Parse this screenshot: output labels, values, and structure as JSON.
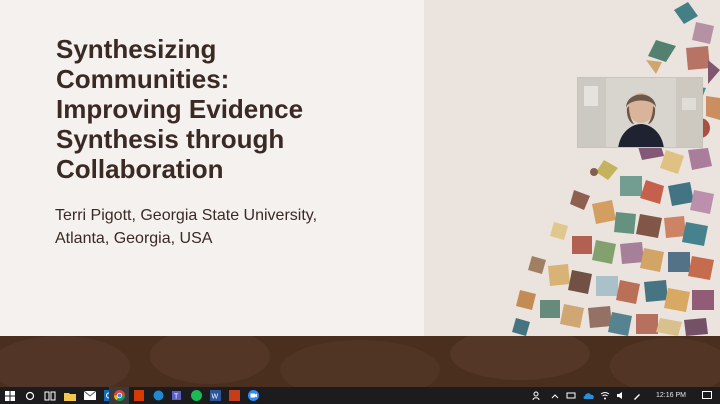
{
  "slide": {
    "title_lines": [
      "Synthesizing",
      "Communities:",
      "Improving Evidence",
      "Synthesis through",
      "Collaboration"
    ],
    "subtitle_lines": [
      "Terri Pigott, Georgia State University,",
      "Atlanta, Georgia, USA"
    ],
    "colors": {
      "title": "#3b2a24",
      "background": "#f4f1ef",
      "band": "#4a2f1f"
    }
  },
  "webcam": {
    "icon": "person-video-icon"
  },
  "taskbar": {
    "icons": [
      "windows-start-icon",
      "search-icon",
      "task-view-icon",
      "file-explorer-icon",
      "mail-icon",
      "outlook-icon",
      "chrome-icon",
      "office-icon",
      "edge-icon",
      "teams-icon",
      "spotify-icon",
      "word-icon",
      "powerpoint-icon",
      "zoom-icon"
    ],
    "tray_icons": [
      "people-icon",
      "chevron-up-icon",
      "network-icon",
      "onedrive-icon",
      "wifi-icon",
      "volume-icon",
      "pen-icon"
    ],
    "time": "12:16 PM",
    "notification_icon": "notification-icon"
  }
}
